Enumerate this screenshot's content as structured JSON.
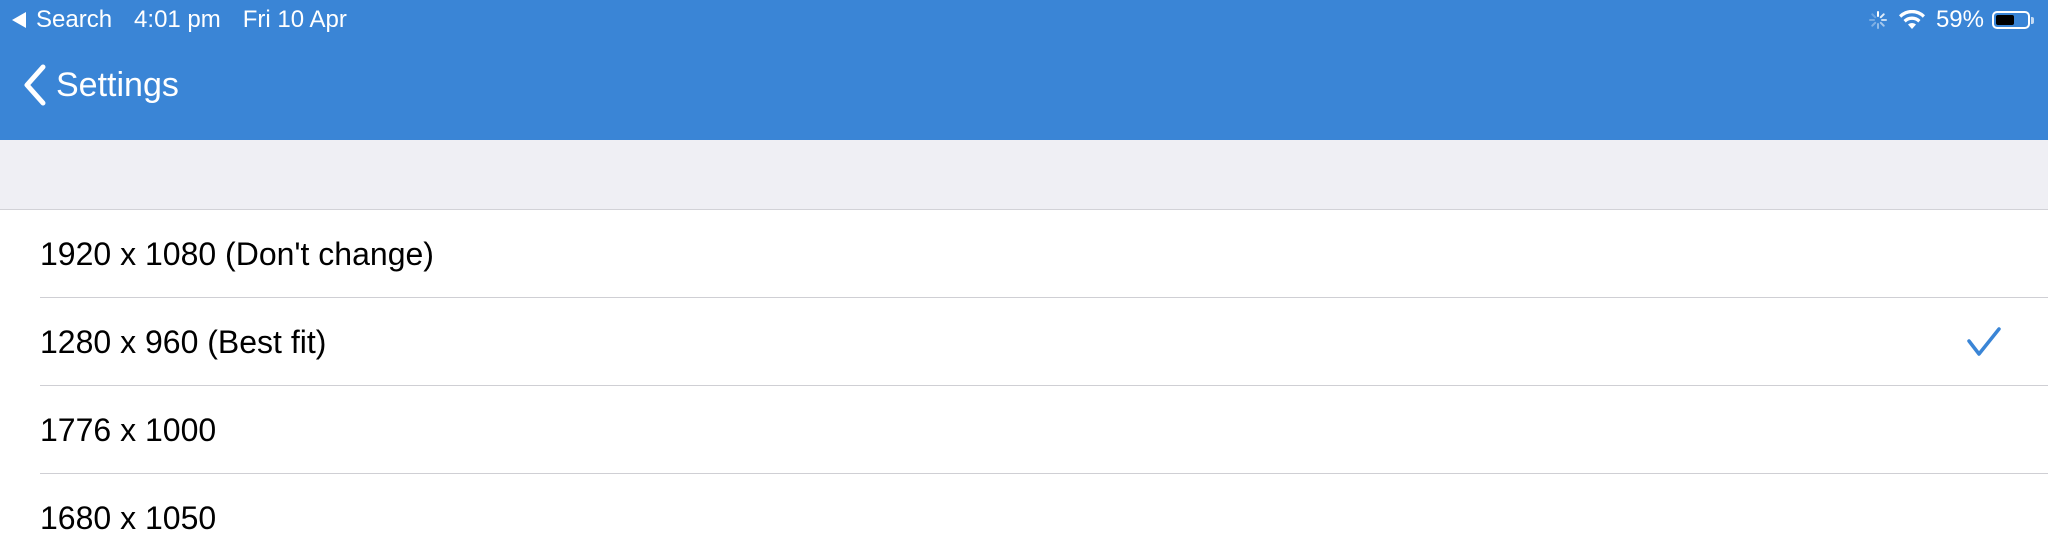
{
  "status_bar": {
    "back_app_label": "Search",
    "time": "4:01 pm",
    "date": "Fri 10 Apr",
    "battery_percent_label": "59%",
    "battery_level": 0.59
  },
  "nav_bar": {
    "back_label": "Settings"
  },
  "colors": {
    "header_blue": "#3a85d6",
    "accent_check": "#3a85d6",
    "group_background": "#efeff4"
  },
  "resolution_list": {
    "items": [
      {
        "label": "1920 x 1080 (Don't change)",
        "selected": false
      },
      {
        "label": "1280 x 960 (Best fit)",
        "selected": true
      },
      {
        "label": "1776 x 1000",
        "selected": false
      },
      {
        "label": "1680 x 1050",
        "selected": false
      }
    ]
  },
  "icons": {
    "status_back": "back-triangle-icon",
    "activity": "activity-spinner-icon",
    "wifi": "wifi-icon",
    "battery": "battery-icon",
    "nav_back": "chevron-left-icon",
    "selected": "checkmark-icon"
  }
}
